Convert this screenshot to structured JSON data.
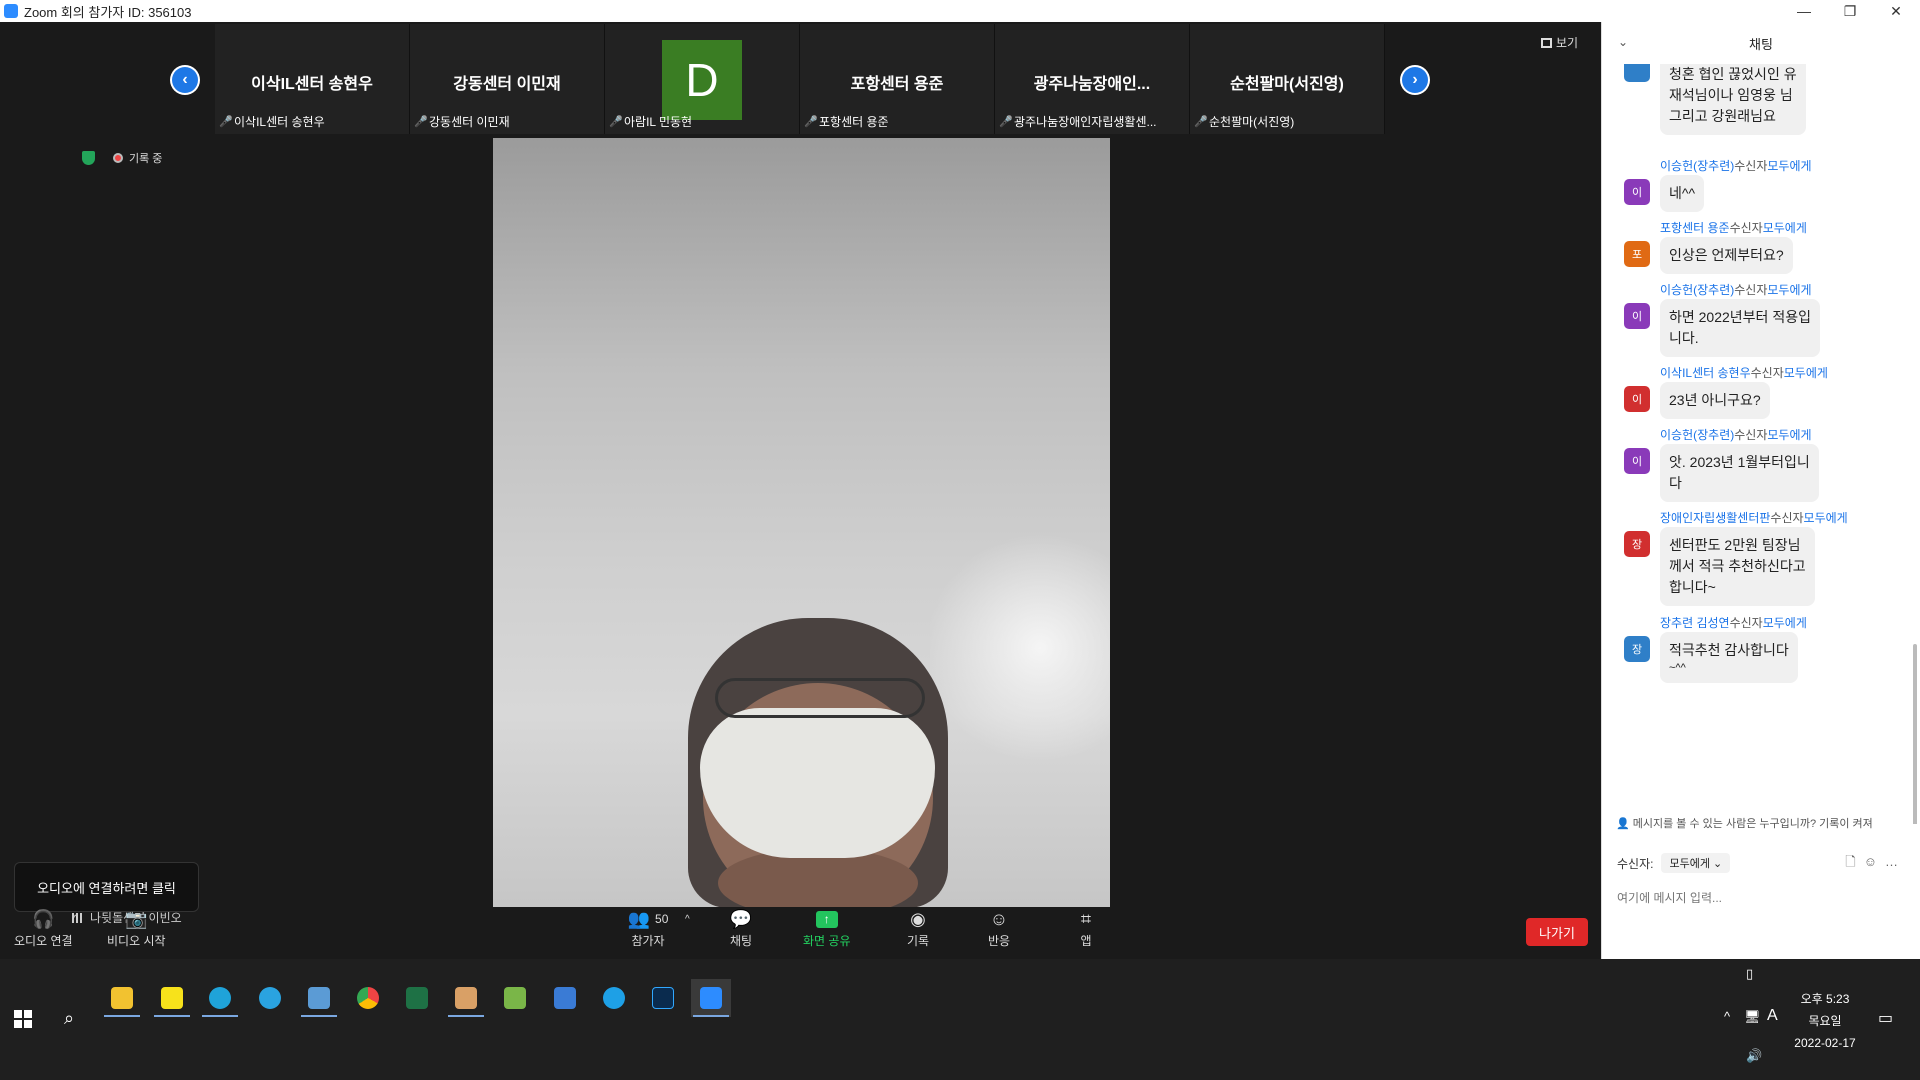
{
  "window": {
    "title": "Zoom 회의 참가자 ID: 356103"
  },
  "thumbnails": [
    {
      "display_name": "이삭IL센터 송현우",
      "label": "이삭IL센터 송현우"
    },
    {
      "display_name": "강동센터 이민재",
      "label": "강동센터 이민재"
    },
    {
      "avatar_letter": "D",
      "label": "아람IL 민동현"
    },
    {
      "display_name": "포항센터 용준",
      "label": "포항센터 용준"
    },
    {
      "display_name": "광주나눔장애인...",
      "label": "광주나눔장애인자립생활센..."
    },
    {
      "display_name": "순천팔마(서진영)",
      "label": "순천팔마(서진영)"
    }
  ],
  "view_button": "보기",
  "recording_status": "기록 중",
  "audio_tooltip": "오디오에 연결하려면 클릭",
  "self_name": "나뒷돌센터 이빈오",
  "toolbar": {
    "audio": "오디오 연결",
    "video": "비디오 시작",
    "participants": "참가자",
    "participants_count": "50",
    "chat": "채팅",
    "share": "화면 공유",
    "record": "기록",
    "reactions": "반응",
    "apps": "앱",
    "leave": "나가기"
  },
  "chat": {
    "title": "채팅",
    "messages": [
      {
        "avatar": "",
        "avatar_color": "#2f7fc8",
        "text_lines": [
          "청혼 협인 끊었시인 유",
          "재석님이나 임영웅 님",
          "그리고 강원래님요"
        ]
      },
      {
        "sender": "이승헌(장추련)",
        "to_label": "수신자",
        "recipient": "모두에게",
        "avatar": "이",
        "avatar_color": "#8a3ab9",
        "text_lines": [
          "네^^"
        ]
      },
      {
        "sender": "포항센터 용준",
        "to_label": "수신자",
        "recipient": "모두에게",
        "avatar": "포",
        "avatar_color": "#e06a14",
        "text_lines": [
          "인상은 언제부터요?"
        ]
      },
      {
        "sender": "이승헌(장추련)",
        "to_label": "수신자",
        "recipient": "모두에게",
        "avatar": "이",
        "avatar_color": "#8a3ab9",
        "text_lines": [
          "하면 2022년부터 적용입",
          "니다."
        ]
      },
      {
        "sender": "이삭IL센터 송현우",
        "to_label": "수신자",
        "recipient": "모두에게",
        "avatar": "이",
        "avatar_color": "#d12f2f",
        "text_lines": [
          "23년 아니구요?"
        ]
      },
      {
        "sender": "이승헌(장추련)",
        "to_label": "수신자",
        "recipient": "모두에게",
        "avatar": "이",
        "avatar_color": "#8a3ab9",
        "text_lines": [
          "앗. 2023년 1월부터입니",
          "다"
        ]
      },
      {
        "sender": "장애인자립생활센터판",
        "to_label": "수신자",
        "recipient": "모두에게",
        "avatar": "장",
        "avatar_color": "#d12f2f",
        "text_lines": [
          "센터판도 2만원 팀장님",
          "께서 적극 추천하신다고",
          "합니다~"
        ]
      },
      {
        "sender": "장추련 김성연",
        "to_label": "수신자",
        "recipient": "모두에게",
        "avatar": "장",
        "avatar_color": "#2f7fc8",
        "text_lines": [
          "적극추천 감사합니다",
          "~^^"
        ]
      }
    ],
    "notice": "메시지를 볼 수 있는 사람은 누구입니까? 기록이 켜져",
    "recipient_label": "수신자:",
    "recipient_value": "모두에게",
    "input_placeholder": "여기에 메시지 입력..."
  },
  "taskbar": {
    "apps": [
      "file-explorer",
      "kakaotalk",
      "edge",
      "telegram",
      "notepad",
      "chrome",
      "excel",
      "app-a",
      "app-b",
      "network-app",
      "internet-explorer",
      "photoshop",
      "zoom"
    ],
    "time": "오후 5:23",
    "weekday": "목요일",
    "date": "2022-02-17",
    "ime": "A"
  }
}
